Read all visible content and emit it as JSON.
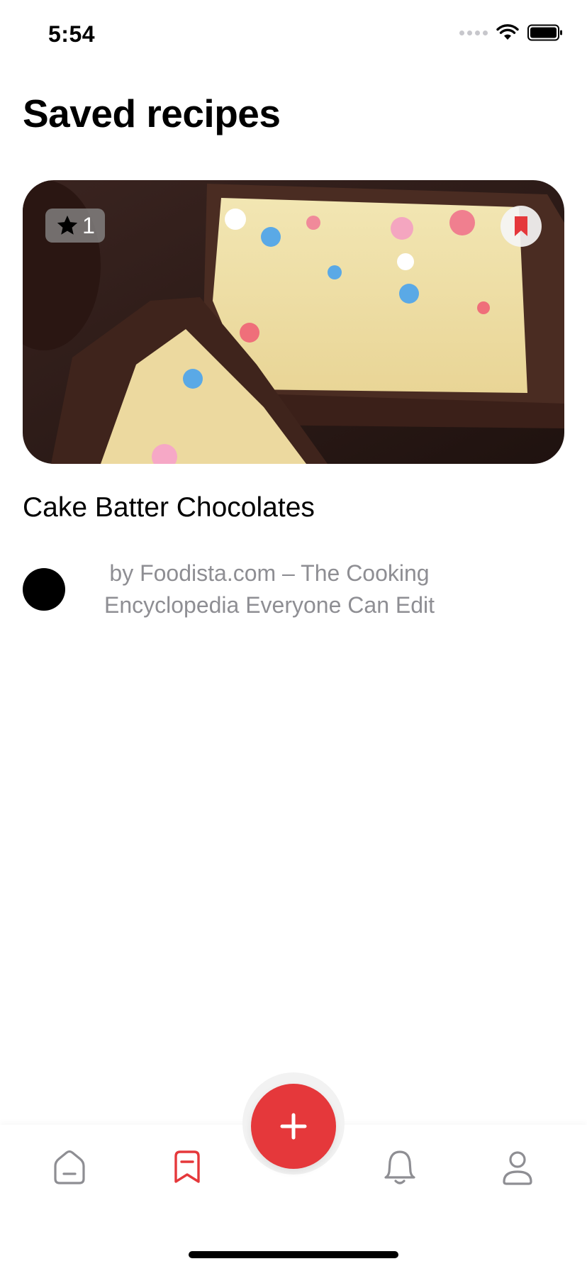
{
  "status_bar": {
    "time": "5:54"
  },
  "header": {
    "title": "Saved recipes"
  },
  "recipe": {
    "title": "Cake Batter Chocolates",
    "rating": "1",
    "author": "by Foodista.com – The Cooking Encyclopedia Everyone Can Edit",
    "saved": true
  },
  "tab_bar": {
    "items": [
      {
        "name": "home",
        "icon": "home-icon",
        "active": false
      },
      {
        "name": "saved",
        "icon": "bookmark-icon",
        "active": true
      },
      {
        "name": "notifications",
        "icon": "bell-icon",
        "active": false
      },
      {
        "name": "profile",
        "icon": "person-icon",
        "active": false
      }
    ],
    "fab_icon": "plus-icon"
  },
  "colors": {
    "accent": "#e5383b",
    "inactive_icon": "#8e8e93",
    "secondary_text": "#8e8e93"
  }
}
